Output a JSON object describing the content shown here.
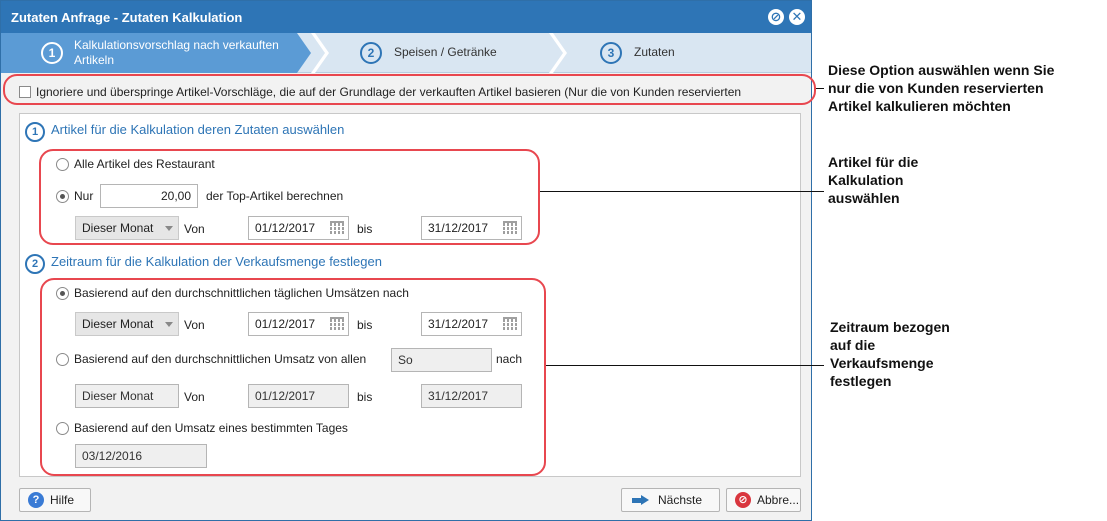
{
  "window": {
    "title": "Zutaten Anfrage - Zutaten Kalkulation"
  },
  "wizard": {
    "steps": [
      {
        "number": "1",
        "label": "Kalkulationsvorschlag nach verkauften Artikeln"
      },
      {
        "number": "2",
        "label": "Speisen / Getränke"
      },
      {
        "number": "3",
        "label": "Zutaten"
      }
    ]
  },
  "ignore_option": {
    "label": "Ignoriere und überspringe Artikel-Vorschläge, die auf der Grundlage der verkauften Artikel basieren (Nur die von Kunden reservierten",
    "checked": false
  },
  "section1": {
    "number": "1",
    "title": "Artikel für die Kalkulation deren Zutaten auswählen",
    "option_all": "Alle Artikel des Restaurant",
    "option_top_prefix": "Nur",
    "option_top_value": "20,00",
    "option_top_suffix": "der Top-Artikel berechnen",
    "period": "Dieser Monat",
    "from_label": "Von",
    "from_date": "01/12/2017",
    "to_label": "bis",
    "to_date": "31/12/2017"
  },
  "section2": {
    "number": "2",
    "title": "Zeitraum für die Kalkulation der Verkaufsmenge festlegen",
    "opt_daily": {
      "label": "Basierend auf den durchschnittlichen täglichen Umsätzen nach",
      "period": "Dieser Monat",
      "from_label": "Von",
      "from_date": "01/12/2017",
      "to_label": "bis",
      "to_date": "31/12/2017"
    },
    "opt_weekday": {
      "label": "Basierend auf den durchschnittlichen Umsatz von allen",
      "day": "So",
      "suffix": "nach",
      "period": "Dieser Monat",
      "from_label": "Von",
      "from_date": "01/12/2017",
      "to_label": "bis",
      "to_date": "31/12/2017"
    },
    "opt_day": {
      "label": "Basierend auf den Umsatz eines bestimmten Tages",
      "date": "03/12/2016"
    }
  },
  "footer": {
    "help": "Hilfe",
    "next": "Nächste",
    "cancel": "Abbre..."
  },
  "annotations": {
    "a1": [
      "Diese Option auswählen wenn Sie",
      "nur die von Kunden reservierten",
      "Artikel kalkulieren möchten"
    ],
    "a2": [
      "Artikel für die",
      "Kalkulation",
      "auswählen"
    ],
    "a3": [
      "Zeitraum bezogen",
      "auf die",
      "Verkaufsmenge",
      "festlegen"
    ]
  },
  "colors": {
    "titlebar": "#2e75b6",
    "active_step": "#5b9bd5",
    "highlight": "#e8474f"
  }
}
